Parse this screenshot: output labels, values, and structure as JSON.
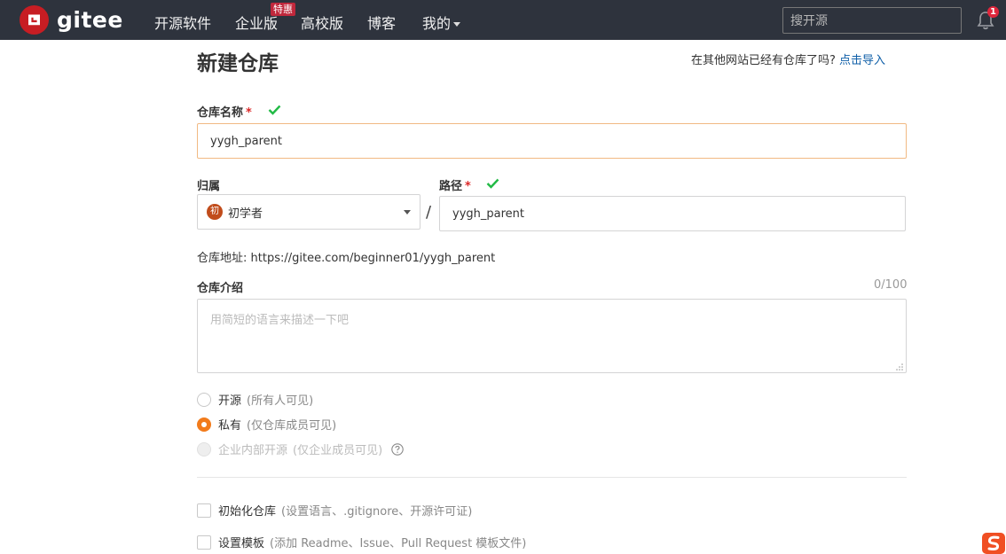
{
  "header": {
    "logo_text": "gitee",
    "nav": [
      {
        "label": "开源软件"
      },
      {
        "label": "企业版"
      },
      {
        "label": "高校版"
      },
      {
        "label": "博客"
      },
      {
        "label": "我的"
      }
    ],
    "promo_badge": "特惠",
    "search_placeholder": "搜开源",
    "notification_count": "1",
    "bg_color": "#2e333d",
    "logo_color": "#c71d23"
  },
  "page": {
    "title": "新建仓库",
    "import_hint": "在其他网站已经有仓库了吗?",
    "import_link": "点击导入"
  },
  "form": {
    "repo_name_label": "仓库名称",
    "required_mark": "*",
    "repo_name_value": "yygh_parent",
    "owner_label": "归属",
    "owner_avatar": "初",
    "owner_value": "初学者",
    "separator": "/",
    "path_label": "路径",
    "path_value": "yygh_parent",
    "repo_address_label": "仓库地址:",
    "repo_address": "https://gitee.com/beginner01/yygh_parent",
    "intro_label": "仓库介绍",
    "intro_counter": "0/100",
    "intro_placeholder": "用简短的语言来描述一下吧",
    "visibility": [
      {
        "label": "开源",
        "sub": "(所有人可见)",
        "checked": false,
        "disabled": false
      },
      {
        "label": "私有",
        "sub": "(仅仓库成员可见)",
        "checked": true,
        "disabled": false
      },
      {
        "label": "企业内部开源",
        "sub": "(仅企业成员可见)",
        "checked": false,
        "disabled": true
      }
    ],
    "init_repo_label": "初始化仓库",
    "init_repo_sub": "(设置语言、.gitignore、开源许可证)",
    "template_label": "设置模板",
    "template_sub": "(添加 Readme、Issue、Pull Request 模板文件)",
    "accent_color": "#f27b1b",
    "check_color": "#21ba45"
  }
}
